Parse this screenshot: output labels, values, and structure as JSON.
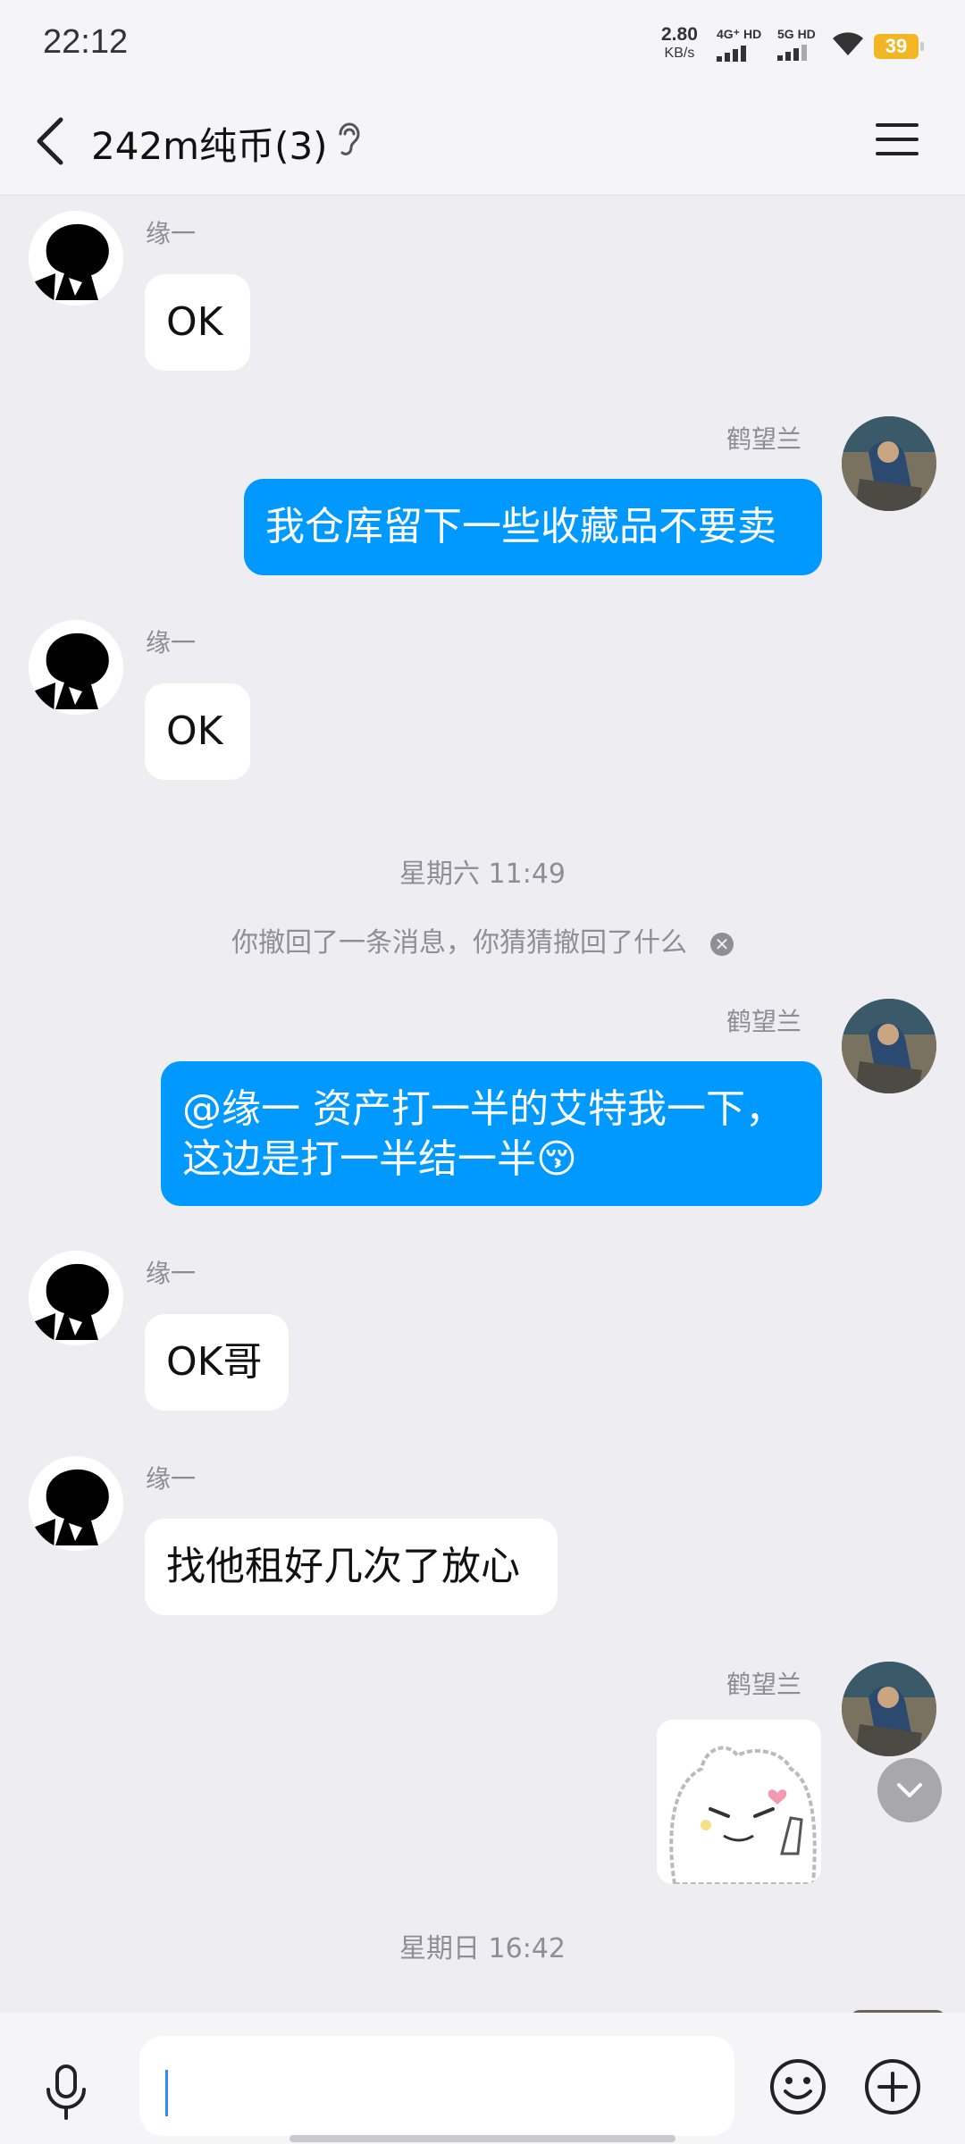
{
  "status_bar": {
    "time": "22:12",
    "net_speed_value": "2.80",
    "net_speed_unit": "KB/s",
    "sim1": "4G⁺ HD",
    "sim2": "5G HD",
    "battery": "39"
  },
  "header": {
    "title": "242m纯币(3)"
  },
  "messages": [
    {
      "sender": "缘一",
      "text": "OK"
    },
    {
      "sender": "鹤望兰",
      "text": "我仓库留下一些收藏品不要卖"
    },
    {
      "sender": "缘一",
      "text": "OK"
    },
    {
      "timestamp": "星期六 11:49"
    },
    {
      "system": "你撤回了一条消息，你猜猜撤回了什么"
    },
    {
      "sender": "鹤望兰",
      "line1": "@缘一 资产打一半的艾特我一下，",
      "line2": "这边是打一半结一半😚"
    },
    {
      "sender": "缘一",
      "text": "OK哥"
    },
    {
      "sender": "缘一",
      "text": "找他租好几次了放心"
    },
    {
      "sender": "鹤望兰",
      "sticker": "bear-sticker"
    },
    {
      "timestamp": "星期日 16:42"
    }
  ],
  "input": {
    "placeholder": ""
  },
  "colors": {
    "outgoing_bubble": "#0099FF",
    "incoming_bubble": "#FFFFFF",
    "background": "#EDEDF2"
  }
}
